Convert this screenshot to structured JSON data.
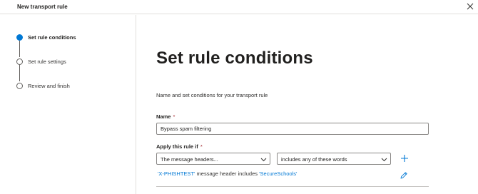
{
  "window": {
    "title": "New transport rule",
    "close_icon": "close-icon"
  },
  "steps": [
    {
      "label": "Set rule conditions",
      "state": "active"
    },
    {
      "label": "Set rule settings",
      "state": "pending"
    },
    {
      "label": "Review and finish",
      "state": "pending"
    }
  ],
  "main": {
    "heading": "Set rule conditions",
    "description": "Name and set conditions for your transport rule",
    "name_field": {
      "label": "Name",
      "required_mark": "*",
      "value": "Bypass spam filtering"
    },
    "condition": {
      "label": "Apply this rule if",
      "required_mark": "*",
      "property_select": "The message headers...",
      "operator_select": "includes any of these words",
      "add_icon": "plus-icon",
      "edit_icon": "pencil-icon",
      "summary": {
        "header_name": "'X-PHISHTEST'",
        "middle_text": "message header includes",
        "words": "'SecureSchools'"
      }
    }
  },
  "colors": {
    "accent": "#0078d4",
    "required": "#a4262c",
    "border": "#8a8886"
  }
}
